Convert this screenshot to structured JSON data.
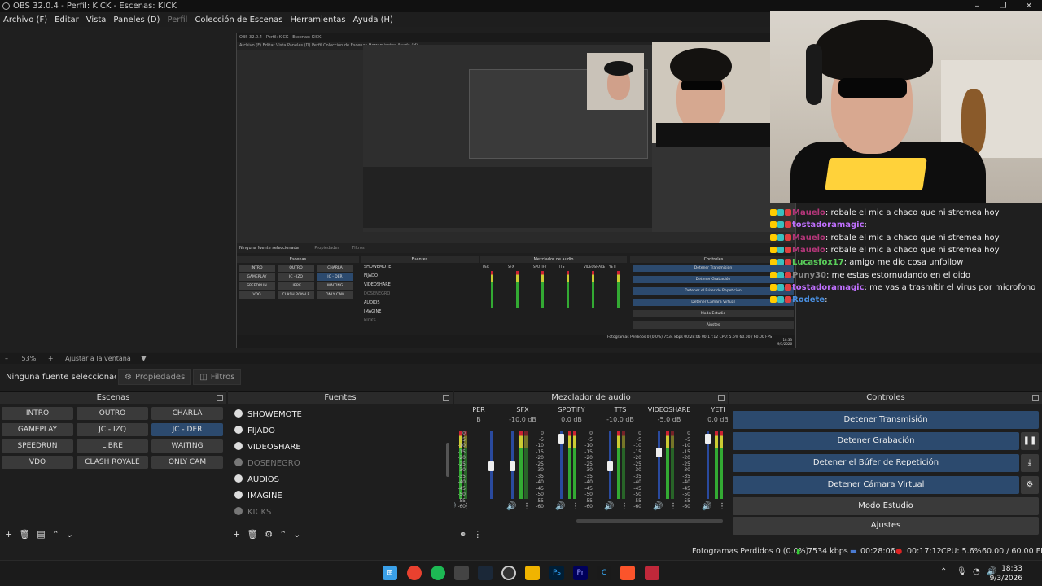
{
  "window": {
    "title": "OBS 32.0.4 - Perfil: KICK - Escenas: KICK",
    "minimize": "–",
    "maximize": "❐",
    "close": "✕"
  },
  "menu": [
    "Archivo (F)",
    "Editar",
    "Vista",
    "Paneles (D)",
    "Perfil",
    "Colección de Escenas",
    "Herramientas",
    "Ayuda (H)"
  ],
  "capture": {
    "title": "OBS 32.0.4 - Perfil: KICK - Escenas: KICK",
    "menu": "Archivo (F)   Editar   Vista   Paneles (D)   Perfil   Colección de Escenas   Herramientas   Ayuda (H)",
    "no_source": "Ninguna fuente seleccionada",
    "props": "Propiedades",
    "filters": "Filtros",
    "docks": {
      "scenes": "Escenas",
      "sources": "Fuentes",
      "mixer": "Mezclador de audio",
      "controls": "Controles"
    },
    "scenes": [
      "INTRO",
      "OUTRO",
      "CHARLA",
      "GAMEPLAY",
      "JC - IZQ",
      "JC - DER",
      "SPEEDRUN",
      "LIBRE",
      "WAITING",
      "VDO",
      "CLASH ROYALE",
      "ONLY CAM"
    ],
    "sources": [
      "SHOWEMOTE",
      "FIJADO",
      "VIDEOSHARE",
      "DOSENEGRO",
      "AUDIOS",
      "IMAGINE",
      "KICKS"
    ],
    "channels": [
      "PER",
      "SFX",
      "SPOTIFY",
      "TTS",
      "VIDEOSHARE",
      "YETI"
    ],
    "controls": [
      "Detener Transmisión",
      "Detener Grabación",
      "Detener el Búfer de Repetición",
      "Detener Cámara Virtual",
      "Modo Estudio",
      "Ajustes"
    ],
    "status": "Fotogramas Perdidos 0 (0.0%)   7534 kbps   00:28:06   00:17:12   CPU: 5.6%   60.00 / 60.00 FPS",
    "clock_time": "18:33",
    "clock_date": "9/3/2026"
  },
  "chat": [
    {
      "user": "Mauelo",
      "msg": ": robale el mic a chaco que ni stremea hoy",
      "color": "#b5367a"
    },
    {
      "user": "tostadoramagic",
      "msg": ":",
      "color": "#c070ff"
    },
    {
      "user": "Mauelo",
      "msg": ": robale el mic a chaco que ni stremea hoy",
      "color": "#b5367a"
    },
    {
      "user": "Mauelo",
      "msg": ": robale el mic a chaco que ni stremea hoy",
      "color": "#b5367a"
    },
    {
      "user": "Lucasfox17",
      "msg": ": amigo me dio cosa unfollow",
      "color": "#5ad05a"
    },
    {
      "user": "Puny30",
      "msg": ": me estas estornudando en el oido",
      "color": "#888888"
    },
    {
      "user": "tostadoramagic",
      "msg": ": me vas a trasmitir el virus por microfono",
      "color": "#c070ff"
    },
    {
      "user": "Rodete",
      "msg": ":",
      "color": "#4a90e2"
    }
  ],
  "zoom": {
    "minus": "–",
    "value": "53%",
    "plus": "+",
    "fit": "Ajustar a la ventana"
  },
  "source_toolbar": {
    "selected": "Ninguna fuente seleccionada",
    "properties": "Propiedades",
    "filters": "Filtros"
  },
  "docks": {
    "scenes": "Escenas",
    "sources": "Fuentes",
    "mixer": "Mezclador de audio",
    "controls": "Controles"
  },
  "scenes": [
    {
      "label": "INTRO"
    },
    {
      "label": "OUTRO"
    },
    {
      "label": "CHARLA"
    },
    {
      "label": "GAMEPLAY"
    },
    {
      "label": "JC - IZQ"
    },
    {
      "label": "JC - DER",
      "selected": true
    },
    {
      "label": "SPEEDRUN"
    },
    {
      "label": "LIBRE"
    },
    {
      "label": "WAITING"
    },
    {
      "label": "VDO"
    },
    {
      "label": "CLASH ROYALE"
    },
    {
      "label": "ONLY CAM"
    }
  ],
  "sources": [
    {
      "label": "SHOWEMOTE",
      "visible": true
    },
    {
      "label": "FIJADO",
      "visible": true
    },
    {
      "label": "VIDEOSHARE",
      "visible": true
    },
    {
      "label": "DOSENEGRO",
      "visible": false
    },
    {
      "label": "AUDIOS",
      "visible": true
    },
    {
      "label": "IMAGINE",
      "visible": true
    },
    {
      "label": "KICKS",
      "visible": false
    }
  ],
  "mixer": {
    "scale": [
      "0",
      "-5",
      "-10",
      "-15",
      "-20",
      "-25",
      "-30",
      "-35",
      "-40",
      "-45",
      "-50",
      "-55",
      "-60"
    ],
    "channels": [
      {
        "name": "PER",
        "db": "B",
        "level": 0.55
      },
      {
        "name": "SFX",
        "db": "-10.0 dB",
        "level": 0.55
      },
      {
        "name": "SPOTIFY",
        "db": "0.0 dB",
        "level": 0.95
      },
      {
        "name": "TTS",
        "db": "-10.0 dB",
        "level": 0.55
      },
      {
        "name": "VIDEOSHARE",
        "db": "-5.0 dB",
        "level": 0.75
      },
      {
        "name": "YETI",
        "db": "0.0 dB",
        "level": 0.95
      }
    ]
  },
  "controls": {
    "stop_stream": "Detener Transmisión",
    "stop_record": "Detener Grabación",
    "stop_replay": "Detener el Búfer de Repetición",
    "stop_vcam": "Detener Cámara Virtual",
    "studio": "Modo Estudio",
    "settings": "Ajustes"
  },
  "status": {
    "dropped": "Fotogramas Perdidos 0 (0.0%)",
    "bitrate": "7534 kbps",
    "stream_time": "00:28:06",
    "rec_time": "00:17:12",
    "cpu": "CPU: 5.6%",
    "fps": "60.00 / 60.00 FPS"
  },
  "taskbar": {
    "time": "18:33",
    "date": "9/3/2026"
  }
}
